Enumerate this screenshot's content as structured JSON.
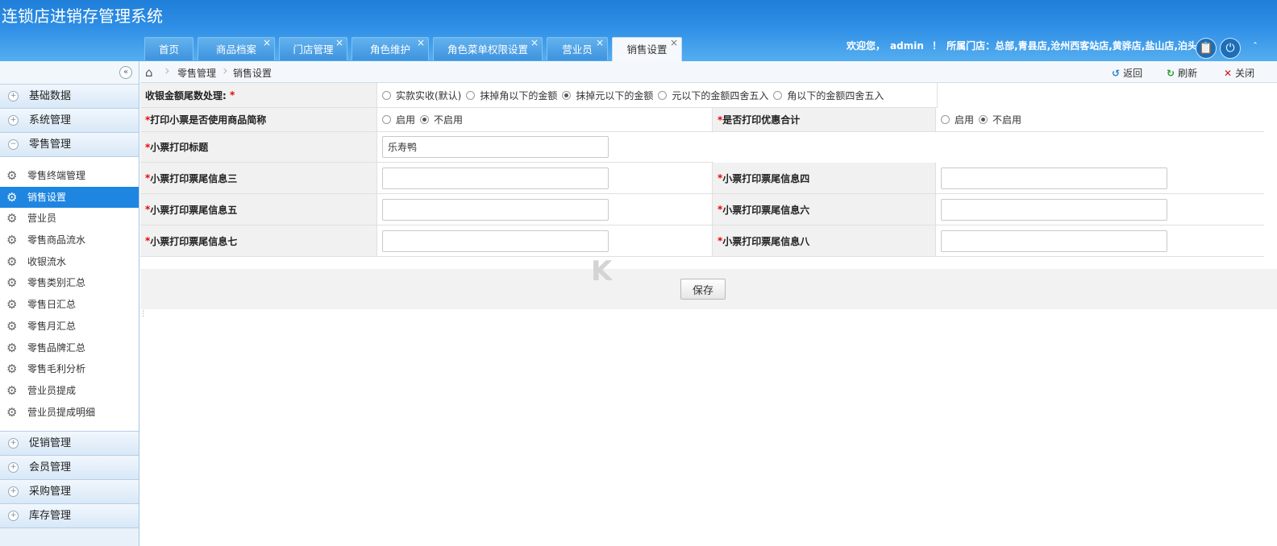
{
  "app": {
    "title": "连锁店进销存管理系统"
  },
  "tabs": [
    {
      "label": "首页",
      "closable": false,
      "active": false
    },
    {
      "label": "商品档案",
      "closable": true,
      "active": false
    },
    {
      "label": "门店管理",
      "closable": true,
      "active": false
    },
    {
      "label": "角色维护",
      "closable": true,
      "active": false
    },
    {
      "label": "角色菜单权限设置",
      "closable": true,
      "active": false
    },
    {
      "label": "营业员",
      "closable": true,
      "active": false
    },
    {
      "label": "销售设置",
      "closable": true,
      "active": true
    }
  ],
  "header": {
    "welcome": "欢迎您，",
    "username": "admin",
    "exclaim": "！",
    "store_label": "所属门店：",
    "stores": "总部,青县店,沧州西客站店,黄骅店,盐山店,泊头店",
    "close_glyph": "×"
  },
  "sidebar": {
    "groups_top": [
      {
        "label": "基础数据",
        "expanded": false
      },
      {
        "label": "系统管理",
        "expanded": false
      },
      {
        "label": "零售管理",
        "expanded": true
      }
    ],
    "retail_items": [
      {
        "label": "零售终端管理",
        "active": false
      },
      {
        "label": "销售设置",
        "active": true
      },
      {
        "label": "营业员",
        "active": false
      },
      {
        "label": "零售商品流水",
        "active": false
      },
      {
        "label": "收银流水",
        "active": false
      },
      {
        "label": "零售类别汇总",
        "active": false
      },
      {
        "label": "零售日汇总",
        "active": false
      },
      {
        "label": "零售月汇总",
        "active": false
      },
      {
        "label": "零售品牌汇总",
        "active": false
      },
      {
        "label": "零售毛利分析",
        "active": false
      },
      {
        "label": "营业员提成",
        "active": false
      },
      {
        "label": "营业员提成明细",
        "active": false
      }
    ],
    "groups_bottom": [
      {
        "label": "促销管理"
      },
      {
        "label": "会员管理"
      },
      {
        "label": "采购管理"
      },
      {
        "label": "库存管理"
      }
    ]
  },
  "breadcrumb": {
    "level1": "零售管理",
    "level2": "销售设置",
    "back": "返回",
    "refresh": "刷新",
    "close": "关闭"
  },
  "form": {
    "rounding": {
      "label": "收银金额尾数处理:",
      "star": "*",
      "options": [
        {
          "label": "实款实收(默认)",
          "checked": false
        },
        {
          "label": "抹掉角以下的金额",
          "checked": false
        },
        {
          "label": "抹掉元以下的金额",
          "checked": true
        },
        {
          "label": "元以下的金额四舍五入",
          "checked": false
        },
        {
          "label": "角以下的金额四舍五入",
          "checked": false
        }
      ]
    },
    "short_name": {
      "star": "*",
      "label": "打印小票是否使用商品简称",
      "options": [
        {
          "label": "启用",
          "checked": false
        },
        {
          "label": "不启用",
          "checked": true
        }
      ]
    },
    "discount_total": {
      "star": "*",
      "label": "是否打印优惠合计",
      "options": [
        {
          "label": "启用",
          "checked": false
        },
        {
          "label": "不启用",
          "checked": true
        }
      ]
    },
    "ticket_title": {
      "star": "*",
      "label": "小票打印标题",
      "value": "乐寿鸭"
    },
    "footers": [
      {
        "star": "*",
        "label": "小票打印票尾信息三",
        "value": ""
      },
      {
        "star": "*",
        "label": "小票打印票尾信息四",
        "value": ""
      },
      {
        "star": "*",
        "label": "小票打印票尾信息五",
        "value": ""
      },
      {
        "star": "*",
        "label": "小票打印票尾信息六",
        "value": ""
      },
      {
        "star": "*",
        "label": "小票打印票尾信息七",
        "value": ""
      },
      {
        "star": "*",
        "label": "小票打印票尾信息八",
        "value": ""
      }
    ],
    "save_label": "保存"
  },
  "watermark": "K",
  "colors": {
    "header_blue": "#2f8fe6",
    "active_item": "#1e86e0",
    "required": "#ee0000"
  }
}
